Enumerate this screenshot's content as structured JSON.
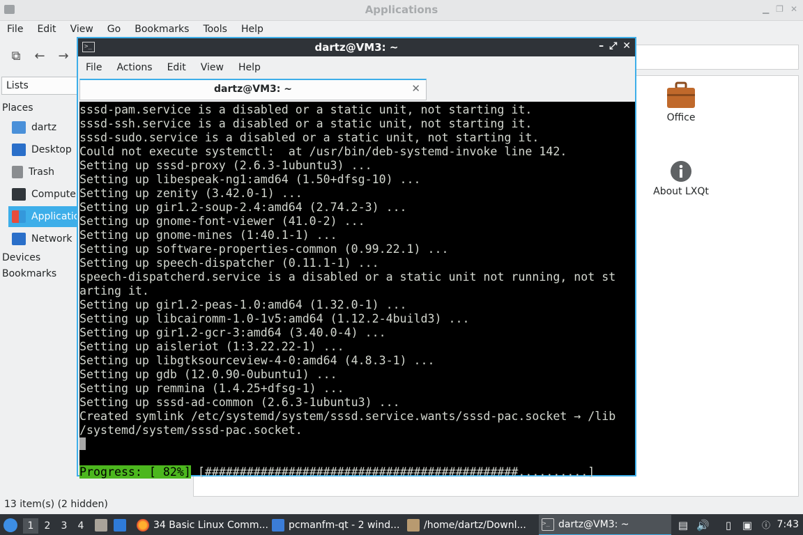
{
  "file_manager": {
    "title": "Applications",
    "menu": [
      "File",
      "Edit",
      "View",
      "Go",
      "Bookmarks",
      "Tools",
      "Help"
    ],
    "sidebar": {
      "view_selector": "Lists",
      "places_header": "Places",
      "places": [
        "dartz",
        "Desktop",
        "Trash",
        "Computer",
        "Applications",
        "Network"
      ],
      "devices_header": "Devices",
      "bookmarks_header": "Bookmarks"
    },
    "items": [
      {
        "label": "Office",
        "icon": "briefcase-icon"
      },
      {
        "label": "About LXQt",
        "icon": "info-icon"
      }
    ],
    "status": "13 item(s) (2 hidden)"
  },
  "terminal": {
    "title": "dartz@VM3: ~",
    "menu": [
      "File",
      "Actions",
      "Edit",
      "View",
      "Help"
    ],
    "tab_label": "dartz@VM3: ~",
    "lines": [
      "sssd-pam.service is a disabled or a static unit, not starting it.",
      "sssd-ssh.service is a disabled or a static unit, not starting it.",
      "sssd-sudo.service is a disabled or a static unit, not starting it.",
      "Could not execute systemctl:  at /usr/bin/deb-systemd-invoke line 142.",
      "Setting up sssd-proxy (2.6.3-1ubuntu3) ...",
      "Setting up libespeak-ng1:amd64 (1.50+dfsg-10) ...",
      "Setting up zenity (3.42.0-1) ...",
      "Setting up gir1.2-soup-2.4:amd64 (2.74.2-3) ...",
      "Setting up gnome-font-viewer (41.0-2) ...",
      "Setting up gnome-mines (1:40.1-1) ...",
      "Setting up software-properties-common (0.99.22.1) ...",
      "Setting up speech-dispatcher (0.11.1-1) ...",
      "speech-dispatcherd.service is a disabled or a static unit not running, not st",
      "arting it.",
      "Setting up gir1.2-peas-1.0:amd64 (1.32.0-1) ...",
      "Setting up libcairomm-1.0-1v5:amd64 (1.12.2-4build3) ...",
      "Setting up gir1.2-gcr-3:amd64 (3.40.0-4) ...",
      "Setting up aisleriot (1:3.22.22-1) ...",
      "Setting up libgtksourceview-4-0:amd64 (4.8.3-1) ...",
      "Setting up gdb (12.0.90-0ubuntu1) ...",
      "Setting up remmina (1.4.25+dfsg-1) ...",
      "Setting up sssd-ad-common (2.6.3-1ubuntu3) ...",
      "Created symlink /etc/systemd/system/sssd.service.wants/sssd-pac.socket → /lib",
      "/systemd/system/sssd-pac.socket."
    ],
    "progress_label": "Progress: [ 82%]",
    "progress_bar": " [#############################################..........]",
    "progress_value": 0.82
  },
  "taskbar": {
    "workspaces": [
      "1",
      "2",
      "3",
      "4"
    ],
    "active_workspace": "1",
    "tasks": [
      {
        "label": "34 Basic Linux Comm...",
        "icon": "firefox-icon"
      },
      {
        "label": "pcmanfm-qt - 2 wind...",
        "icon": "folder-icon"
      },
      {
        "label": "/home/dartz/Downl...",
        "icon": "archive-icon"
      },
      {
        "label": "dartz@VM3: ~",
        "icon": "terminal-icon"
      }
    ],
    "clock": "7:43"
  },
  "colors": {
    "accent": "#3daee9",
    "progress": "#4cb71e",
    "titlebar": "#2f3338"
  }
}
